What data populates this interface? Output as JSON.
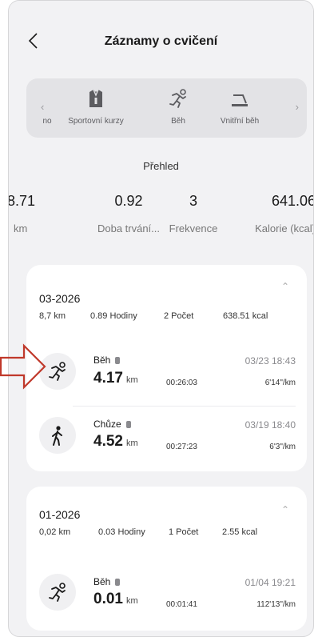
{
  "header": {
    "title": "Záznamy o cvičení"
  },
  "categories": {
    "items": [
      {
        "label": "no",
        "icon": "partial-icon"
      },
      {
        "label": "Sportovní kurzy",
        "icon": "tshirt-icon"
      },
      {
        "label": "Běh",
        "icon": "running-icon"
      },
      {
        "label": "Vnitřní běh",
        "icon": "treadmill-icon"
      }
    ]
  },
  "overview": {
    "title": "Přehled",
    "stats": [
      {
        "value": "8.71",
        "label": "km"
      },
      {
        "value": "0.92",
        "label": "Doba trvání..."
      },
      {
        "value": "3",
        "label": "Frekvence"
      },
      {
        "value": "641.06",
        "label": "Kalorie (kcal)"
      }
    ]
  },
  "months": [
    {
      "month": "03-2026",
      "summary": {
        "distance": "8,7 km",
        "hours": "0.89 Hodiny",
        "count": "2 Počet",
        "kcal": "638.51 kcal"
      },
      "workouts": [
        {
          "type": "Běh",
          "icon": "running-icon",
          "distance": "4.17",
          "unit": "km",
          "duration": "00:26:03",
          "date": "03/23 18:43",
          "pace": "6'14\"/km"
        },
        {
          "type": "Chůze",
          "icon": "walking-icon",
          "distance": "4.52",
          "unit": "km",
          "duration": "00:27:23",
          "date": "03/19 18:40",
          "pace": "6'3\"/km"
        }
      ]
    },
    {
      "month": "01-2026",
      "summary": {
        "distance": "0,02 km",
        "hours": "0.03 Hodiny",
        "count": "1 Počet",
        "kcal": "2.55 kcal"
      },
      "workouts": [
        {
          "type": "Běh",
          "icon": "running-icon",
          "distance": "0.01",
          "unit": "km",
          "duration": "00:01:41",
          "date": "01/04 19:21",
          "pace": "112'13\"/km"
        }
      ]
    }
  ],
  "colors": {
    "annotation_arrow": "#c0392b",
    "background": "#f2f2f4",
    "card": "#ffffff"
  }
}
